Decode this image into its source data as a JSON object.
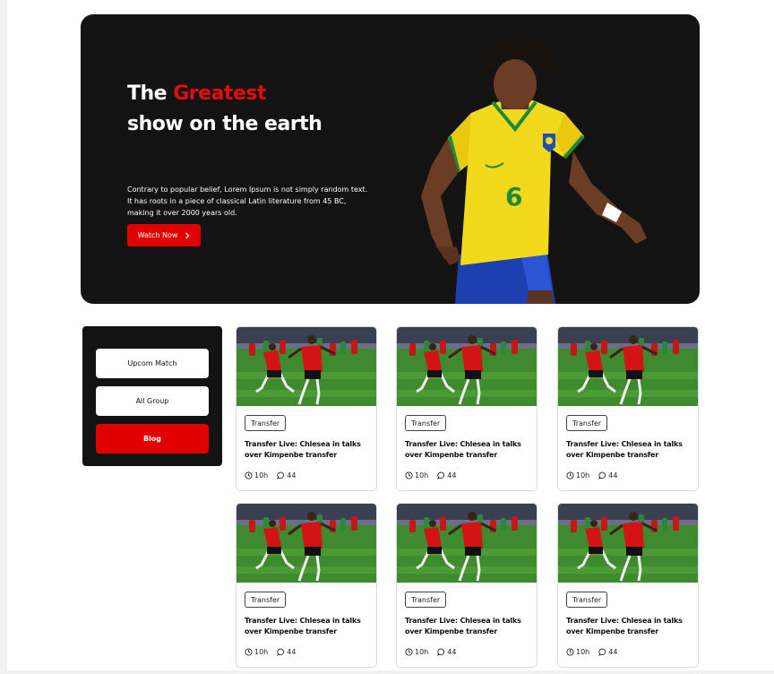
{
  "hero": {
    "title_part1": "The ",
    "title_accent": "Greatest",
    "title_part2": "show on the earth",
    "description": "Contrary to popular belief, Lorem Ipsum is not simply random text. It has roots in a piece of classical Latin literature from 45 BC, making it over 2000 years old.",
    "cta_label": "Watch Now",
    "cta_icon": "chevron-right-icon",
    "jersey_number": "6",
    "accent_color": "#e30b0b"
  },
  "sidebar": {
    "items": [
      {
        "label": "Upcom Match"
      },
      {
        "label": "All Group"
      },
      {
        "label": "Blog",
        "active": true
      }
    ]
  },
  "cards": [
    {
      "tag": "Transfer",
      "title": "Transfer Live: Chlesea in talks over Kimpenbe transfer",
      "time": "10h",
      "comments": "44"
    },
    {
      "tag": "Transfer",
      "title": "Transfer Live: Chlesea in talks over Kimpenbe transfer",
      "time": "10h",
      "comments": "44"
    },
    {
      "tag": "Transfer",
      "title": "Transfer Live: Chlesea in talks over Kimpenbe transfer",
      "time": "10h",
      "comments": "44"
    },
    {
      "tag": "Transfer",
      "title": "Transfer Live: Chlesea in talks over Kimpenbe transfer",
      "time": "10h",
      "comments": "44"
    },
    {
      "tag": "Transfer",
      "title": "Transfer Live: Chlesea in talks over Kimpenbe transfer",
      "time": "10h",
      "comments": "44"
    },
    {
      "tag": "Transfer",
      "title": "Transfer Live: Chlesea in talks over Kimpenbe transfer",
      "time": "10h",
      "comments": "44"
    }
  ]
}
